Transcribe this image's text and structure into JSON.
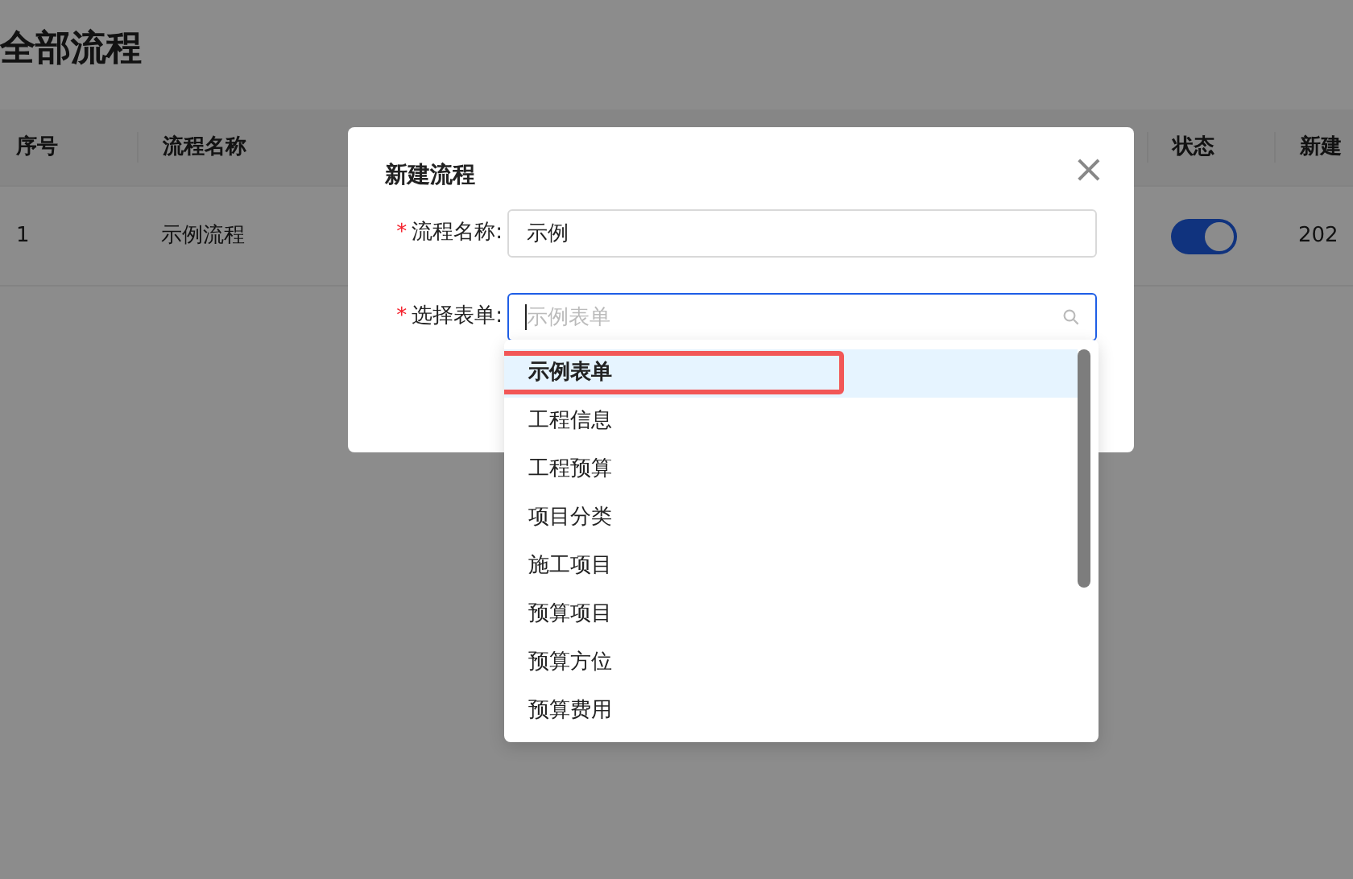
{
  "page": {
    "title": "全部流程"
  },
  "table": {
    "columns": [
      {
        "label": "序号"
      },
      {
        "label": "流程名称"
      },
      {
        "label": "状态"
      },
      {
        "label": "新建"
      }
    ],
    "rows": [
      {
        "index": "1",
        "name": "示例流程",
        "status_on": true,
        "created": "202"
      }
    ]
  },
  "dialog": {
    "title": "新建流程",
    "close": "×",
    "fields": [
      {
        "label": "流程名称:",
        "required": true,
        "required_mark": "*",
        "kind": "text",
        "value": "示例",
        "focused": false
      },
      {
        "label": "选择表单:",
        "required": true,
        "required_mark": "*",
        "kind": "select",
        "placeholder": "示例表单",
        "focused": true
      }
    ],
    "options": [
      {
        "label": "示例表单",
        "selected": true,
        "annotated": true
      },
      {
        "label": "工程信息",
        "selected": false,
        "annotated": false
      },
      {
        "label": "工程预算",
        "selected": false,
        "annotated": false
      },
      {
        "label": "项目分类",
        "selected": false,
        "annotated": false
      },
      {
        "label": "施工项目",
        "selected": false,
        "annotated": false
      },
      {
        "label": "预算项目",
        "selected": false,
        "annotated": false
      },
      {
        "label": "预算方位",
        "selected": false,
        "annotated": false
      },
      {
        "label": "预算费用",
        "selected": false,
        "annotated": false
      }
    ]
  }
}
